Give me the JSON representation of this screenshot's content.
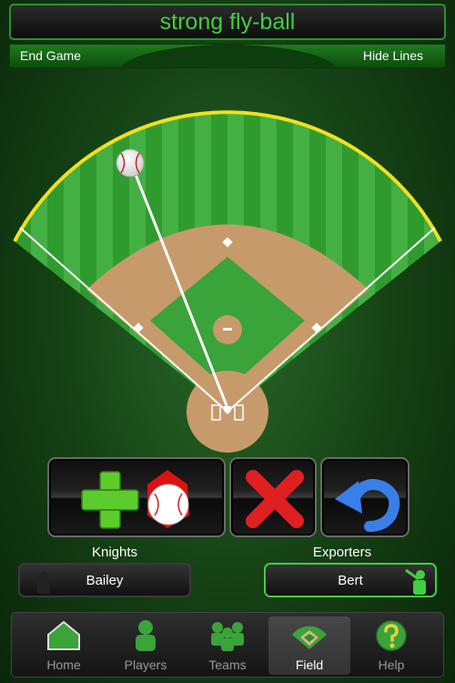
{
  "status": {
    "play_text": "strong fly-ball"
  },
  "toolbar": {
    "end_game_label": "End Game",
    "hide_lines_label": "Hide Lines"
  },
  "teams": {
    "away": {
      "name": "Knights",
      "player": "Bailey"
    },
    "home": {
      "name": "Exporters",
      "player": "Bert"
    }
  },
  "actions": [
    {
      "icon": "add-ball-icon"
    },
    {
      "icon": "delete-x-icon"
    },
    {
      "icon": "undo-arrow-icon"
    }
  ],
  "tabs": [
    {
      "label": "Home",
      "icon": "home-icon",
      "active": false
    },
    {
      "label": "Players",
      "icon": "player-icon",
      "active": false
    },
    {
      "label": "Teams",
      "icon": "teams-icon",
      "active": false
    },
    {
      "label": "Field",
      "icon": "field-icon",
      "active": true
    },
    {
      "label": "Help",
      "icon": "help-icon",
      "active": false
    }
  ],
  "colors": {
    "accent_green": "#3fd03f",
    "toolbar_green": "#1f7a1f",
    "dirt": "#c79a6c",
    "warning_track": "#f0e020"
  }
}
